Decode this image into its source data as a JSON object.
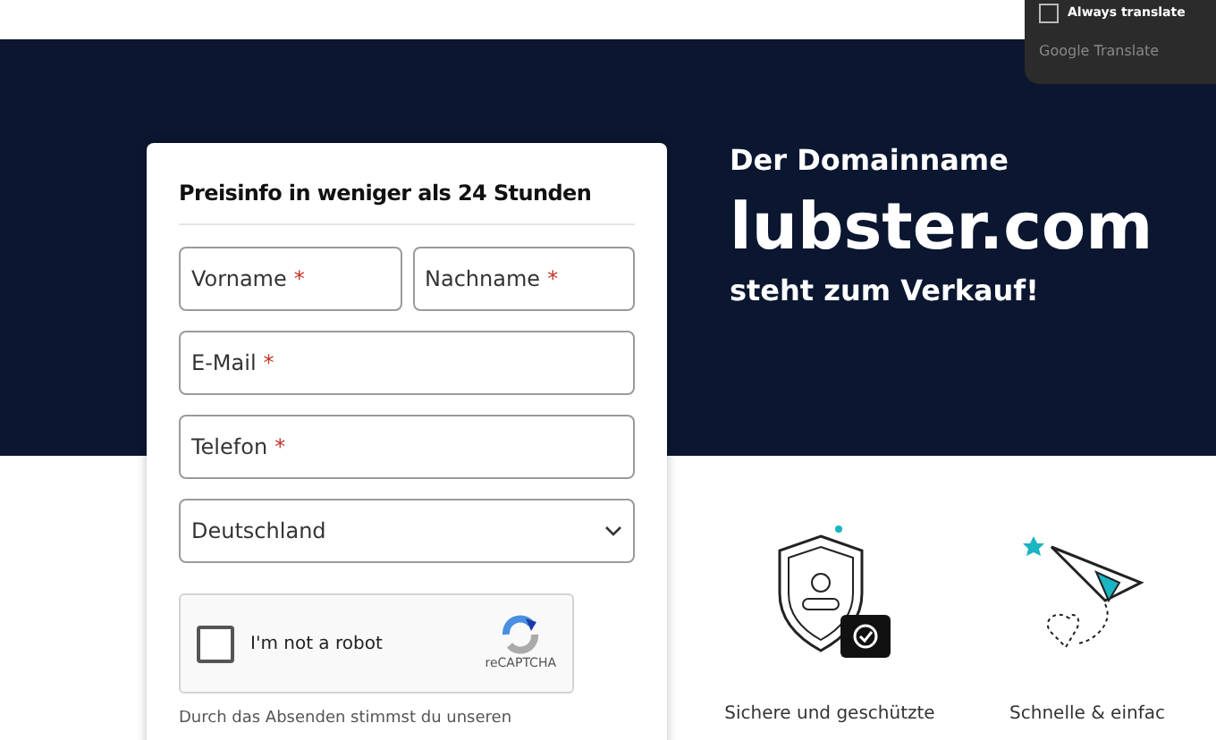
{
  "translate_popup": {
    "checkbox_label": "Always translate",
    "checked": false,
    "footer": "Google Translate"
  },
  "hero": {
    "eyebrow": "Der Domainname",
    "domain": "lubster.com",
    "tagline": "steht zum Verkauf!"
  },
  "form": {
    "title": "Preisinfo in weniger als 24 Stunden",
    "fields": [
      {
        "placeholder": "Vorname",
        "required": true
      },
      {
        "placeholder": "Nachname",
        "required": true
      },
      {
        "placeholder": "E-Mail",
        "required": true
      },
      {
        "placeholder": "Telefon",
        "required": true
      }
    ],
    "required_mark": "*",
    "country": {
      "value": "Deutschland"
    },
    "captcha": {
      "label": "I'm not a robot",
      "brand": "reCAPTCHA",
      "checked": false
    },
    "consent": "Durch das Absenden stimmst du unseren"
  },
  "features": [
    {
      "kind": "shield",
      "caption": "Sichere und geschützte"
    },
    {
      "kind": "plane",
      "caption": "Schnelle & einfac"
    }
  ]
}
